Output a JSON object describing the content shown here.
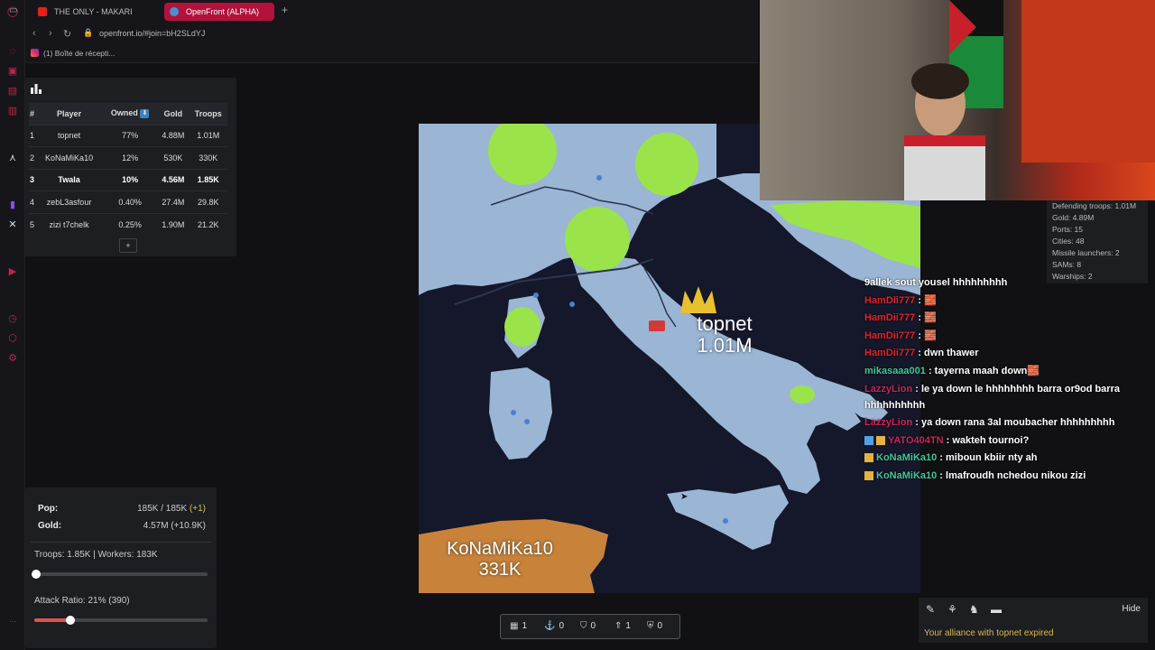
{
  "browser": {
    "tabs": [
      {
        "label": "THE ONLY - MAKARI"
      },
      {
        "label": "OpenFront (ALPHA)"
      }
    ],
    "new_tab": "+",
    "url": "openfront.io/#join=bH2SLdYJ",
    "bookmark": "(1) Boîte de récepti..."
  },
  "leaderboard": {
    "headers": [
      "#",
      "Player",
      "Owned",
      "Gold",
      "Troops"
    ],
    "rows": [
      {
        "rank": "1",
        "player": "topnet",
        "owned": "77%",
        "gold": "4.88M",
        "troops": "1.01M"
      },
      {
        "rank": "2",
        "player": "KoNaMiKa10",
        "owned": "12%",
        "gold": "530K",
        "troops": "330K"
      },
      {
        "rank": "3",
        "player": "Twala",
        "owned": "10%",
        "gold": "4.56M",
        "troops": "1.85K"
      },
      {
        "rank": "4",
        "player": "zebL3asfour",
        "owned": "0.40%",
        "gold": "27.4M",
        "troops": "29.8K"
      },
      {
        "rank": "5",
        "player": "zizi t7chelk",
        "owned": "0.25%",
        "gold": "1.90M",
        "troops": "21.2K"
      }
    ],
    "more": "+"
  },
  "map": {
    "topnet_name": "topnet",
    "topnet_troops": "1.01M",
    "konami_name": "KoNaMiKa10",
    "konami_troops": "331K"
  },
  "infobox": {
    "lines": [
      "Defending troops: 1.01M",
      "Gold: 4.89M",
      "Ports: 15",
      "Cities: 48",
      "Missile launchers: 2",
      "SAMs: 8",
      "Warships: 2"
    ]
  },
  "chat": [
    {
      "user": "",
      "msg": "9allek sout yousel hhhhhhhhh"
    },
    {
      "user": "HamDii777",
      "msg": " : 🧱"
    },
    {
      "user": "HamDii777",
      "msg": " : 🧱"
    },
    {
      "user": "HamDii777",
      "msg": " : 🧱"
    },
    {
      "user": "HamDii777",
      "msg": " : dwn thawer"
    },
    {
      "user": "mikasaaa001",
      "msg": " : tayerna maah down🧱"
    },
    {
      "user": "LazzyLion",
      "msg": " : le ya down le hhhhhhhh barra or9od barra hhhhhhhhhh"
    },
    {
      "user": "LazzyLion",
      "msg": " : ya down rana 3al moubacher hhhhhhhhh"
    },
    {
      "user": "YATO404TN",
      "msg": " : wakteh tournoi?"
    },
    {
      "user": "KoNaMiKa10",
      "msg": " : miboun kbiir nty ah"
    },
    {
      "user": "KoNaMiKa10",
      "msg": " : lmafroudh nchedou nikou zizi"
    }
  ],
  "stats": {
    "pop_label": "Pop:",
    "pop_value": "185K / 185K",
    "pop_inc": "(+1)",
    "gold_label": "Gold:",
    "gold_value": "4.57M (+10.9K)",
    "troops_workers": "Troops: 1.85K | Workers: 183K",
    "troops_ratio": 0.01,
    "attack_ratio_label": "Attack Ratio: 21% (390)",
    "attack_ratio": 0.21
  },
  "bottombar": {
    "cities": "1",
    "ports": "0",
    "defense": "0",
    "missiles": "1",
    "sams": "0"
  },
  "brpanel": {
    "hide": "Hide",
    "message": "Your alliance with topnet expired"
  },
  "colors": {
    "accent": "#b3123d",
    "land": "#9ab6d4",
    "ocean": "#15172a",
    "green_territory": "#9be34a",
    "orange_territory": "#c8823a"
  }
}
